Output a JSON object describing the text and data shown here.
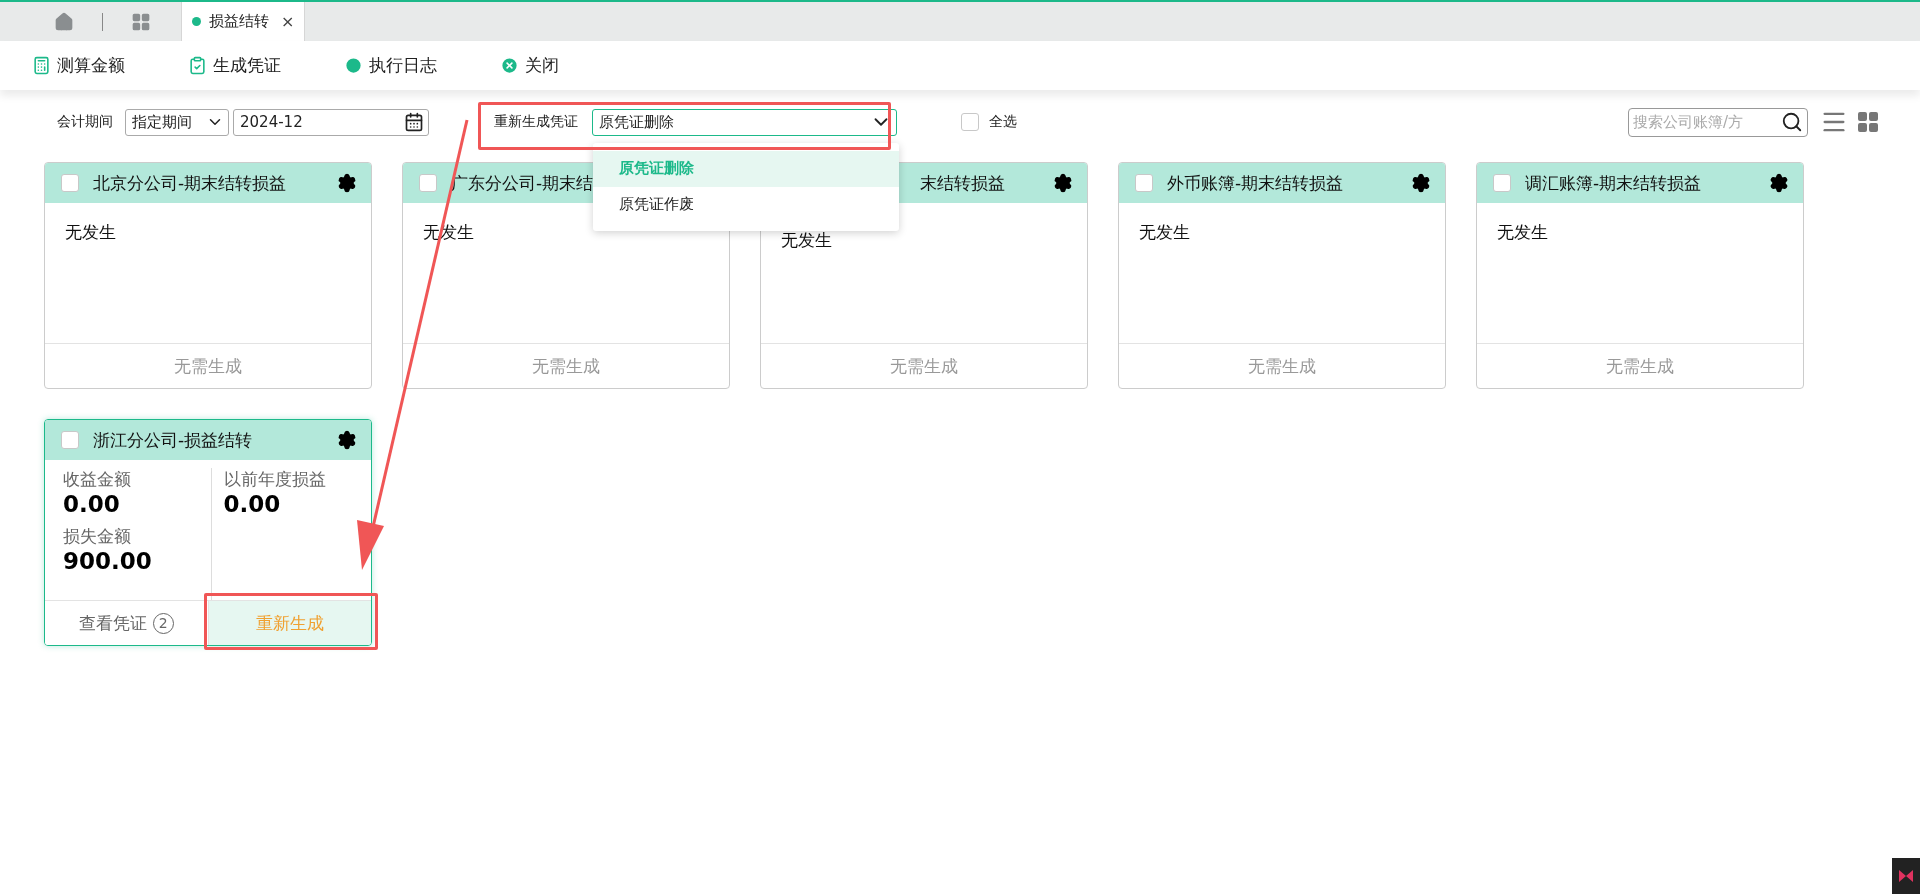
{
  "tab_bar": {
    "tabs": [
      {
        "label": "损益结转",
        "selected": true,
        "close": "×"
      }
    ]
  },
  "toolbar": [
    {
      "label": "测算金额"
    },
    {
      "label": "生成凭证"
    },
    {
      "label": "执行日志"
    },
    {
      "label": "关闭"
    }
  ],
  "filters": {
    "period_label": "会计期间",
    "period_mode": "指定期间",
    "period": "2024-12",
    "regen_label": "重新生成凭证",
    "regen_value": "原凭证删除",
    "regen_expanded": true,
    "regen_options": [
      {
        "label": "原凭证删除",
        "selected": true
      },
      {
        "label": "原凭证作废",
        "selected": false
      }
    ],
    "select_all": {
      "label": "全选",
      "checked": false
    },
    "search": {
      "placeholder": "搜索公司账簿/方"
    }
  },
  "cards": [
    {
      "kind": "empty",
      "title": "北京分公司-期末结转损益",
      "checked": false,
      "active": false,
      "body": "无发生",
      "footer": "无需生成"
    },
    {
      "kind": "covered_right",
      "title": "广东分公司-期末结",
      "checked": false,
      "active": false,
      "body": "无发生",
      "footer": "无需生成"
    },
    {
      "kind": "covered",
      "title": "末结转损益",
      "active": false,
      "body": "无发生",
      "footer": "无需生成"
    },
    {
      "kind": "empty",
      "title": "外币账簿-期末结转损益",
      "checked": false,
      "active": false,
      "body": "无发生",
      "footer": "无需生成"
    },
    {
      "kind": "empty",
      "title": "调汇账簿-期末结转损益",
      "checked": false,
      "active": false,
      "body": "无发生",
      "footer": "无需生成"
    },
    {
      "kind": "result",
      "title": "浙江分公司-损益结转",
      "checked": false,
      "active": true,
      "metrics": [
        {
          "label": "收益金额",
          "value": "0.00"
        },
        {
          "label": "损失金额",
          "value": "900.00"
        }
      ],
      "side_metric": {
        "label": "以前年度损益",
        "value": "0.00"
      },
      "view_label": "查看凭证",
      "view_count": "2",
      "regen": "重新生成"
    }
  ],
  "annotations": [
    {
      "kind": "frame"
    },
    {
      "kind": "frame"
    },
    {
      "kind": "arrow"
    }
  ]
}
